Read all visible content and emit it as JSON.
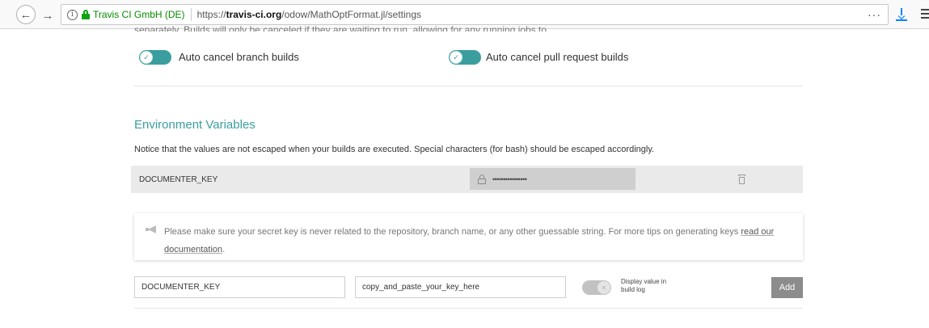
{
  "browser": {
    "org_label": "Travis CI GmbH (DE)",
    "url_prefix": "https://",
    "url_domain": "travis-ci.org",
    "url_path": "/odow/MathOptFormat.jl/settings",
    "more_label": "···"
  },
  "auto_cancel": {
    "cut_text": "separately. Builds will only be canceled if they are waiting to run, allowing for any running jobs to finish.",
    "branch_label": "Auto cancel branch builds",
    "pr_label": "Auto cancel pull request builds",
    "branch_enabled": true,
    "pr_enabled": true
  },
  "env_vars": {
    "title": "Environment Variables",
    "notice": "Notice that the values are not escaped when your builds are executed. Special characters (for bash) should be escaped accordingly.",
    "rows": [
      {
        "name": "DOCUMENTER_KEY",
        "masked_value": "••••••••••••••••"
      }
    ]
  },
  "tip": {
    "text": "Please make sure your secret key is never related to the repository, branch name, or any other guessable string. For more tips on generating keys ",
    "link_part1": "read our",
    "link_part2": "documentation",
    "end": "."
  },
  "add_form": {
    "name_value": "DOCUMENTER_KEY",
    "value_value": "copy_and_paste_your_key_here",
    "display_label": "Display value in build log",
    "display_enabled": false,
    "add_label": "Add"
  },
  "colors": {
    "accent": "#3a9e9e",
    "secure_green": "#058b00",
    "download_blue": "#0a84ff"
  },
  "icons": [
    "back-arrow-icon",
    "forward-arrow-icon",
    "info-icon",
    "lock-icon",
    "download-icon",
    "hamburger-menu-icon",
    "check-icon",
    "padlock-icon",
    "trash-icon",
    "megaphone-icon",
    "x-icon"
  ]
}
